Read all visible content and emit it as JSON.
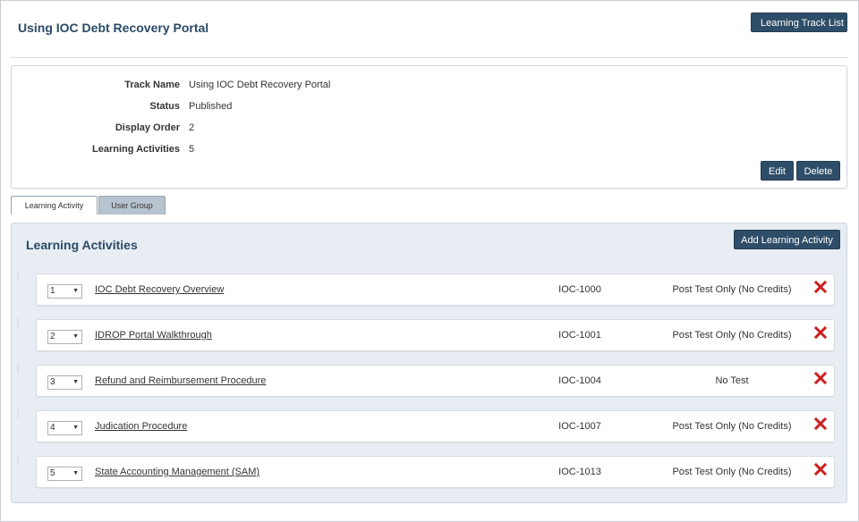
{
  "page": {
    "title": "Using IOC Debt Recovery Portal",
    "track_list_button": "Learning Track List"
  },
  "details": {
    "rows": [
      {
        "label": "Track Name",
        "value": "Using IOC Debt Recovery Portal"
      },
      {
        "label": "Status",
        "value": "Published"
      },
      {
        "label": "Display Order",
        "value": "2"
      },
      {
        "label": "Learning Activities",
        "value": "5"
      }
    ],
    "edit_button": "Edit",
    "delete_button": "Delete"
  },
  "tabs": [
    {
      "label": "Learning Activity",
      "active": true
    },
    {
      "label": "User Group",
      "active": false
    }
  ],
  "activities_panel": {
    "title": "Learning Activities",
    "add_button": "Add Learning Activity",
    "items": [
      {
        "order": "1",
        "name": "IOC Debt Recovery Overview",
        "code": "IOC-1000",
        "test": "Post Test Only (No Credits)"
      },
      {
        "order": "2",
        "name": "IDROP Portal Walkthrough",
        "code": "IOC-1001",
        "test": "Post Test Only (No Credits)"
      },
      {
        "order": "3",
        "name": "Refund and Reimbursement Procedure",
        "code": "IOC-1004",
        "test": "No Test"
      },
      {
        "order": "4",
        "name": "Judication Procedure",
        "code": "IOC-1007",
        "test": "Post Test Only (No Credits)"
      },
      {
        "order": "5",
        "name": "State Accounting Management (SAM)",
        "code": "IOC-1013",
        "test": "Post Test Only (No Credits)"
      }
    ]
  },
  "colors": {
    "primary_button": "#2e4d68",
    "title_text": "#2b4a66",
    "panel_background": "#e7edf3",
    "remove_icon": "#cc1f1f"
  },
  "icons": {
    "remove": "close-x-icon",
    "drag": "drag-handle-icon",
    "select_caret": "caret-down-icon"
  }
}
